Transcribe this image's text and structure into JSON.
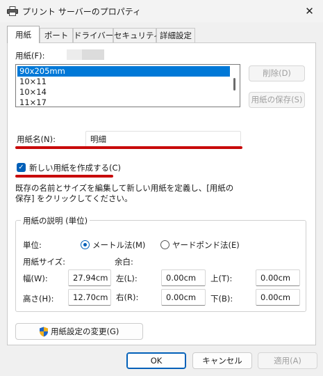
{
  "window": {
    "title": "プリント サーバーのプロパティ",
    "close_symbol": "✕"
  },
  "tabs": [
    {
      "label": "用紙",
      "active": true
    },
    {
      "label": "ポート",
      "active": false
    },
    {
      "label": "ドライバー",
      "active": false
    },
    {
      "label": "セキュリティ",
      "active": false
    },
    {
      "label": "詳細設定",
      "active": false
    }
  ],
  "forms": {
    "label": "用紙(F):",
    "items": [
      "90x205mm",
      "10×11",
      "10×14",
      "11×17"
    ],
    "selected_index": 0
  },
  "buttons": {
    "delete": "削除(D)",
    "save_form": "用紙の保存(S)",
    "change_settings": "用紙設定の変更(G)",
    "ok": "OK",
    "cancel": "キャンセル",
    "apply": "適用(A)"
  },
  "form_name": {
    "label": "用紙名(N):",
    "value": "明細"
  },
  "create_new": {
    "label": "新しい用紙を作成する(C)",
    "checked": true,
    "check_symbol": "✓"
  },
  "description": {
    "line1": "既存の名前とサイズを編集して新しい用紙を定義し、[用紙の",
    "line2": "保存] をクリックしてください。"
  },
  "group": {
    "title": "用紙の説明 (単位)",
    "units_label": "単位:",
    "metric_label": "メートル法(M)",
    "imperial_label": "ヤードポンド法(E)",
    "selected_unit": "metric",
    "paper_size_label": "用紙サイズ:",
    "margins_label": "余白:",
    "width_label": "幅(W):",
    "width_value": "27.94cm",
    "height_label": "高さ(H):",
    "height_value": "12.70cm",
    "left_label": "左(L):",
    "left_value": "0.00cm",
    "right_label": "右(R):",
    "right_value": "0.00cm",
    "top_label": "上(T):",
    "top_value": "0.00cm",
    "bottom_label": "下(B):",
    "bottom_value": "0.00cm"
  },
  "colors": {
    "accent": "#0078d7",
    "annotation_red": "#c80a0a"
  },
  "icons": {
    "app": "printer-icon",
    "close": "close-icon",
    "shield": "uac-shield-icon",
    "check": "checkmark-icon"
  }
}
